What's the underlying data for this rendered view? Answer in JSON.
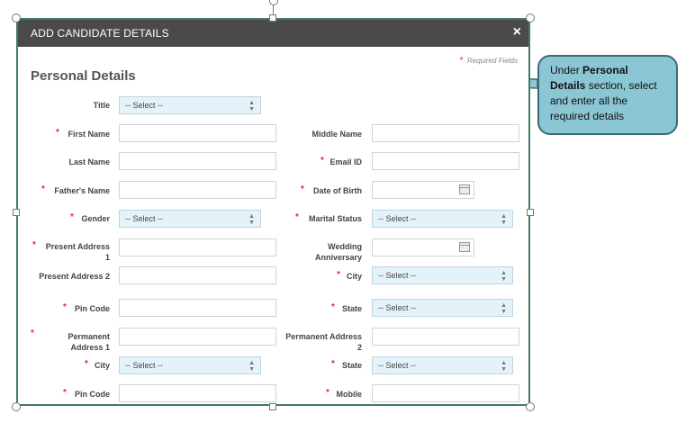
{
  "dialog": {
    "title": "ADD CANDIDATE DETAILS",
    "close": "×",
    "required_note": "Required Fields",
    "required_marker": "*",
    "section_title": "Personal Details"
  },
  "fields": {
    "title": {
      "label": "Title",
      "value": "-- Select --"
    },
    "first_name": {
      "label": "First Name"
    },
    "middle_name": {
      "label": "Middle Name"
    },
    "last_name": {
      "label": "Last Name"
    },
    "email": {
      "label": "Email ID"
    },
    "fathers_name": {
      "label": "Father's Name"
    },
    "dob": {
      "label": "Date of Birth"
    },
    "gender": {
      "label": "Gender",
      "value": "-- Select --"
    },
    "marital_status": {
      "label": "Marital Status",
      "value": "-- Select --"
    },
    "present_address1": {
      "label_line1": "Present Address",
      "label_line2": "1"
    },
    "wedding": {
      "label_line1": "Wedding",
      "label_line2": "Anniversary"
    },
    "present_address2": {
      "label": "Present Address 2"
    },
    "city1": {
      "label": "City",
      "value": "-- Select --"
    },
    "pin1": {
      "label": "Pin Code"
    },
    "state1": {
      "label": "State",
      "value": "-- Select --"
    },
    "perm_address1": {
      "label_line1": "Permanent",
      "label_line2": "Address 1"
    },
    "perm_address2": {
      "label_line1": "Permanent Address",
      "label_line2": "2"
    },
    "city2": {
      "label": "City",
      "value": "-- Select --"
    },
    "state2": {
      "label": "State",
      "value": "-- Select --"
    },
    "pin2": {
      "label": "Pin Code"
    },
    "mobile": {
      "label": "Mobile"
    }
  },
  "callout": {
    "part1": "Under ",
    "bold": "Personal Details",
    "part2": " section, select and enter all the required details"
  },
  "colors": {
    "titlebar": "#4a4a4a",
    "select_bg": "#e4f3f9",
    "required": "#e0303a",
    "callout_bg": "#8bc6d4",
    "frame_border": "#3f7a6b"
  }
}
